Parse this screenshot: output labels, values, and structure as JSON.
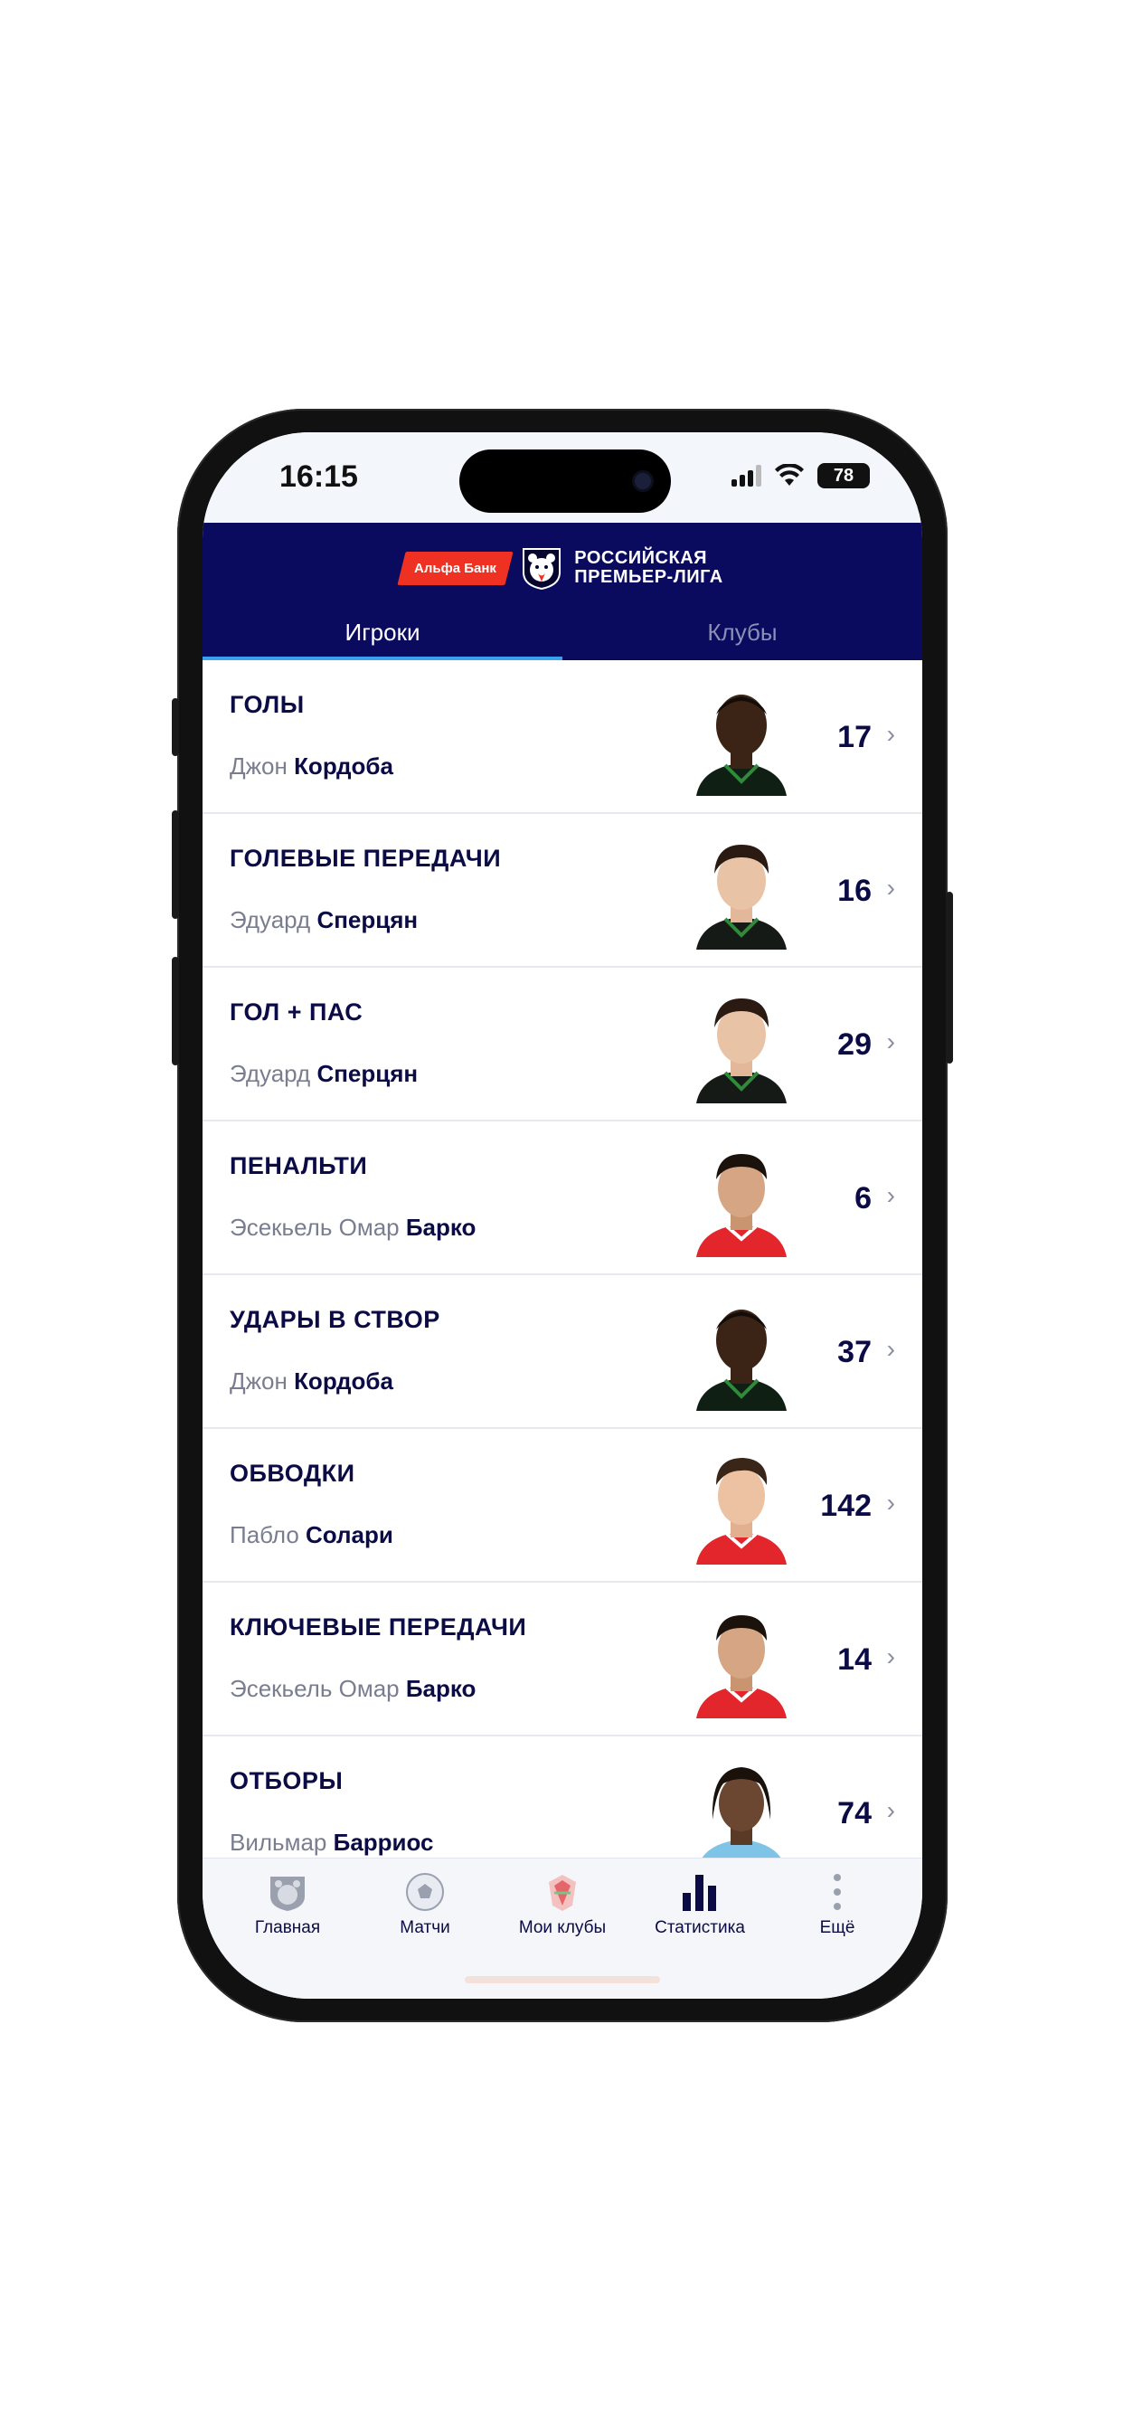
{
  "status_bar": {
    "time": "16:15",
    "battery": "78"
  },
  "header": {
    "bank_logo_text": "Альфа Банк",
    "league_name_line1": "РОССИЙСКАЯ",
    "league_name_line2": "ПРЕМЬЕР-ЛИГА"
  },
  "tabs": [
    {
      "label": "Игроки",
      "active": true
    },
    {
      "label": "Клубы",
      "active": false
    }
  ],
  "stats": [
    {
      "category": "ГОЛЫ",
      "first_name": "Джон",
      "last_name": "Кордоба",
      "value": "17",
      "kit": "dark"
    },
    {
      "category": "ГОЛЕВЫЕ ПЕРЕДАЧИ",
      "first_name": "Эдуард",
      "last_name": "Сперцян",
      "value": "16",
      "kit": "dark"
    },
    {
      "category": "ГОЛ + ПАС",
      "first_name": "Эдуард",
      "last_name": "Сперцян",
      "value": "29",
      "kit": "dark"
    },
    {
      "category": "ПЕНАЛЬТИ",
      "first_name": "Эсекьель Омар",
      "last_name": "Барко",
      "value": "6",
      "kit": "red"
    },
    {
      "category": "УДАРЫ В СТВОР",
      "first_name": "Джон",
      "last_name": "Кордоба",
      "value": "37",
      "kit": "dark"
    },
    {
      "category": "ОБВОДКИ",
      "first_name": "Пабло",
      "last_name": "Солари",
      "value": "142",
      "kit": "red"
    },
    {
      "category": "КЛЮЧЕВЫЕ ПЕРЕДАЧИ",
      "first_name": "Эсекьель Омар",
      "last_name": "Барко",
      "value": "14",
      "kit": "red"
    },
    {
      "category": "ОТБОРЫ",
      "first_name": "Вильмар",
      "last_name": "Барриос",
      "value": "74",
      "kit": "blue"
    }
  ],
  "nav": [
    {
      "label": "Главная",
      "icon": "bear-icon"
    },
    {
      "label": "Матчи",
      "icon": "ball-icon"
    },
    {
      "label": "Мои клубы",
      "icon": "club-crest-icon"
    },
    {
      "label": "Статистика",
      "icon": "stats-bars-icon"
    },
    {
      "label": "Ещё",
      "icon": "more-dots-icon"
    }
  ]
}
